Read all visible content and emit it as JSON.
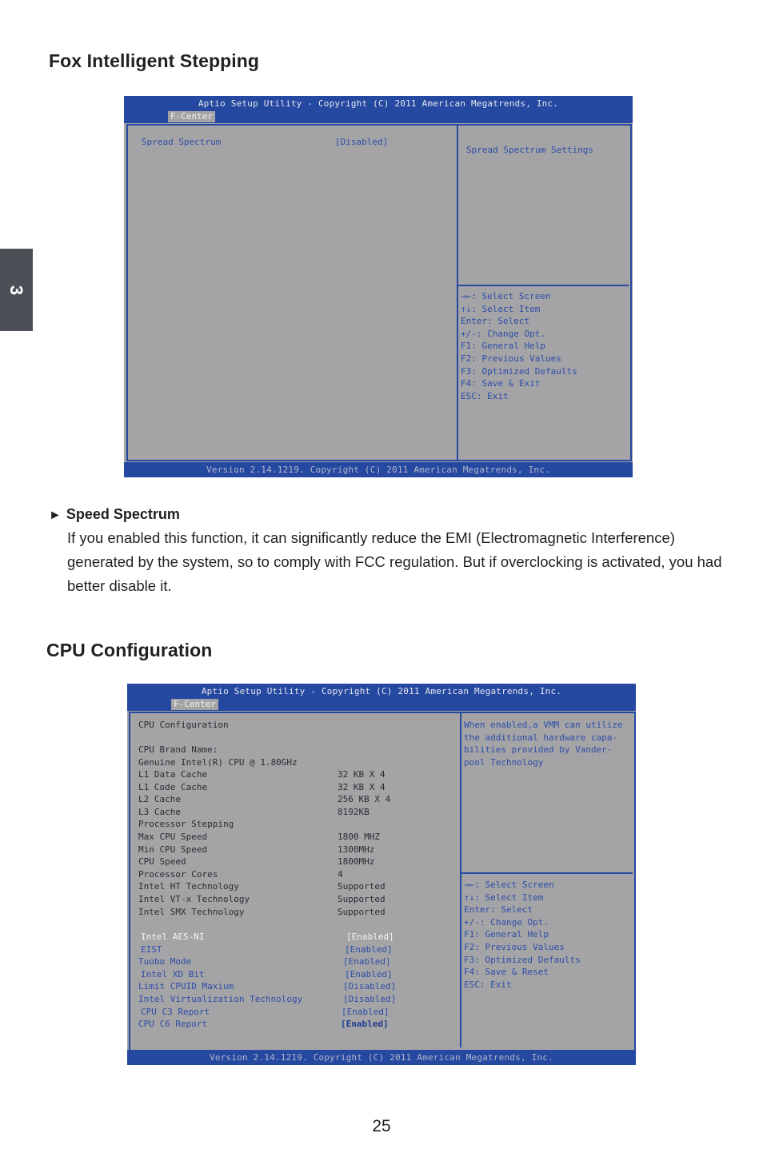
{
  "chapter_tab": "3",
  "sections": {
    "fox": {
      "title": "Fox Intelligent Stepping",
      "bios": {
        "header": "Aptio Setup Utility - Copyright (C) 2011 American Megatrends, Inc.",
        "active_tab": "F-Center",
        "items": [
          {
            "label": "Spread Spectrum",
            "value": "[Disabled]"
          }
        ],
        "help_text": "Spread Spectrum Settings",
        "key_help": [
          "→←: Select Screen",
          "↑↓: Select Item",
          "Enter: Select",
          "+/-: Change Opt.",
          "F1: General Help",
          "F2: Previous Values",
          "F3: Optimized Defaults",
          "F4: Save & Exit",
          "ESC: Exit"
        ],
        "footer": "Version 2.14.1219. Copyright (C) 2011 American Megatrends, Inc."
      },
      "option_heading": "Speed Spectrum",
      "option_bullet": "►",
      "description": "If you enabled this function, it can significantly reduce the EMI (Electromagnetic Interference) generated by the system, so to comply with FCC regulation. But if overclocking is activated, you had better disable it."
    },
    "cpu": {
      "title": "CPU Configuration",
      "bios": {
        "header": "Aptio Setup Utility - Copyright (C) 2011 American Megatrends, Inc.",
        "active_tab": "F-Center",
        "heading": "CPU Configuration",
        "brand_label": "CPU Brand Name:",
        "brand_value": "Genuine Intel(R) CPU @ 1.80GHz",
        "info": [
          {
            "label": "L1 Data Cache",
            "value": "32 KB X 4"
          },
          {
            "label": "L1 Code Cache",
            "value": "32 KB X 4"
          },
          {
            "label": "L2 Cache",
            "value": "256 KB X 4"
          },
          {
            "label": "L3 Cache",
            "value": "8192KB"
          },
          {
            "label": "Processor Stepping",
            "value": ""
          },
          {
            "label": "Max CPU Speed",
            "value": "1800 MHZ"
          },
          {
            "label": "Min CPU Speed",
            "value": "1300MHz"
          },
          {
            "label": "CPU Speed",
            "value": "1800MHz"
          },
          {
            "label": "Processor Cores",
            "value": "4"
          },
          {
            "label": "Intel HT Technology",
            "value": "Supported"
          },
          {
            "label": "Intel VT-x Technology",
            "value": "Supported"
          },
          {
            "label": "Intel SMX Technology",
            "value": "Supported"
          }
        ],
        "options": [
          {
            "label": "Intel AES-NI",
            "value": "[Enabled]",
            "selected": true
          },
          {
            "label": "EIST",
            "value": "[Enabled]"
          },
          {
            "label": "Tuobo Mode",
            "value": "[Enabled]"
          },
          {
            "label": "Intel XD Bit",
            "value": "[Enabled]"
          },
          {
            "label": "Limit CPUID Maxium",
            "value": "[Disabled]"
          },
          {
            "label": "Intel Virtualization Technology",
            "value": "[Disabled]"
          },
          {
            "label": "CPU C3 Report",
            "value": "[Enabled]"
          },
          {
            "label": "CPU C6 Report",
            "value": "[Enabled]"
          }
        ],
        "help_lines": [
          "When enabled,a VMM can utilize",
          "the additional hardware capa-",
          "bilities provided by Vander-",
          "pool Technology"
        ],
        "key_help": [
          "→←: Select Screen",
          "↑↓: Select Item",
          "Enter: Select",
          "+/-: Change Opt.",
          "F1: General Help",
          "F2: Previous Values",
          "F3: Optimized Defaults",
          "F4: Save & Reset",
          "ESC: Exit"
        ],
        "footer": "Version 2.14.1219. Copyright (C) 2011 American Megatrends, Inc."
      }
    }
  },
  "page_number": "25"
}
